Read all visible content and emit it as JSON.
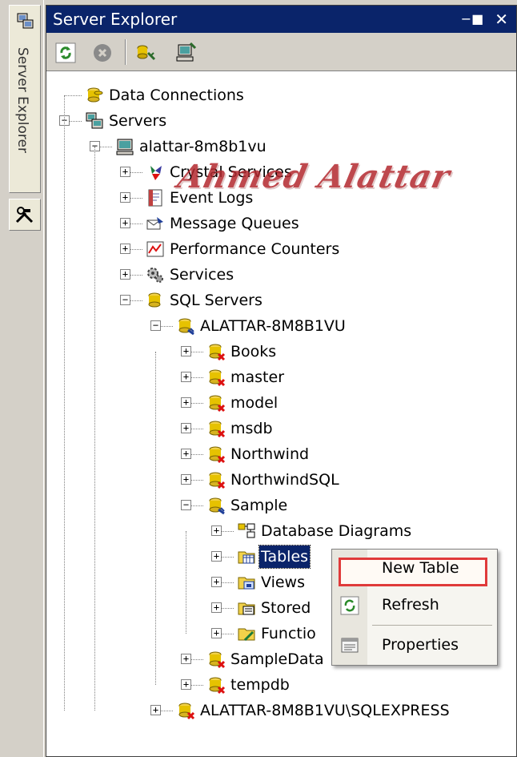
{
  "window": {
    "title": "Server Explorer",
    "pin_glyph": "—■",
    "close_glyph": "✕",
    "side_tab_label": "Server Explorer"
  },
  "watermark": "Ahmed Alattar",
  "tree": [
    {
      "id": "data-connections",
      "label": "Data Connections",
      "icon": "database-connections-icon",
      "expander": ""
    },
    {
      "id": "servers",
      "label": "Servers",
      "icon": "servers-icon",
      "expander": "-"
    },
    {
      "id": "machine",
      "label": "alattar-8m8b1vu",
      "icon": "computer-icon",
      "expander": "-"
    },
    {
      "id": "crystal-services",
      "label": "Crystal Services",
      "icon": "crystal-services-icon",
      "expander": "+"
    },
    {
      "id": "event-logs",
      "label": "Event Logs",
      "icon": "event-log-icon",
      "expander": "+"
    },
    {
      "id": "message-queues",
      "label": "Message Queues",
      "icon": "message-queue-icon",
      "expander": "+"
    },
    {
      "id": "performance-counters",
      "label": "Performance Counters",
      "icon": "performance-counter-icon",
      "expander": "+"
    },
    {
      "id": "services",
      "label": "Services",
      "icon": "services-gear-icon",
      "expander": "+"
    },
    {
      "id": "sql-servers",
      "label": "SQL Servers",
      "icon": "sql-servers-icon",
      "expander": "-"
    },
    {
      "id": "instance",
      "label": "ALATTAR-8M8B1VU",
      "icon": "sql-server-connected-icon",
      "expander": "-"
    },
    {
      "id": "db-books",
      "label": "Books",
      "icon": "database-disconnected-icon",
      "expander": "+"
    },
    {
      "id": "db-master",
      "label": "master",
      "icon": "database-disconnected-icon",
      "expander": "+"
    },
    {
      "id": "db-model",
      "label": "model",
      "icon": "database-disconnected-icon",
      "expander": "+"
    },
    {
      "id": "db-msdb",
      "label": "msdb",
      "icon": "database-disconnected-icon",
      "expander": "+"
    },
    {
      "id": "db-northwind",
      "label": "Northwind",
      "icon": "database-disconnected-icon",
      "expander": "+"
    },
    {
      "id": "db-northwindsql",
      "label": "NorthwindSQL",
      "icon": "database-disconnected-icon",
      "expander": "+"
    },
    {
      "id": "db-sample",
      "label": "Sample",
      "icon": "database-connected-icon",
      "expander": "-"
    },
    {
      "id": "database-diagrams",
      "label": "Database Diagrams",
      "icon": "database-diagram-icon",
      "expander": "+"
    },
    {
      "id": "tables",
      "label": "Tables",
      "icon": "tables-folder-icon",
      "expander": "+",
      "selected": true
    },
    {
      "id": "views",
      "label": "Views",
      "icon": "views-folder-icon",
      "expander": "+"
    },
    {
      "id": "stored-procedures",
      "label": "Stored",
      "icon": "stored-procedures-icon",
      "expander": "+"
    },
    {
      "id": "functions",
      "label": "Functio",
      "icon": "functions-icon",
      "expander": "+"
    },
    {
      "id": "db-sampledata",
      "label": "SampleData",
      "icon": "database-disconnected-icon",
      "expander": "+"
    },
    {
      "id": "db-tempdb",
      "label": "tempdb",
      "icon": "database-disconnected-icon",
      "expander": "+"
    },
    {
      "id": "instance-sqlexpress",
      "label": "ALATTAR-8M8B1VU\\SQLEXPRESS",
      "icon": "sql-server-disconnected-icon",
      "expander": "+"
    }
  ],
  "context_menu": {
    "items": [
      {
        "id": "new-table",
        "label": "New Table",
        "icon": "",
        "highlighted": true
      },
      {
        "id": "refresh",
        "label": "Refresh",
        "icon": "refresh-icon"
      },
      {
        "id": "properties",
        "label": "Properties",
        "icon": "properties-icon"
      }
    ]
  },
  "colors": {
    "title_bar": "#0a246a",
    "selection": "#0a246a",
    "highlight_border": "#e03a3a",
    "watermark": "#b3292f"
  }
}
